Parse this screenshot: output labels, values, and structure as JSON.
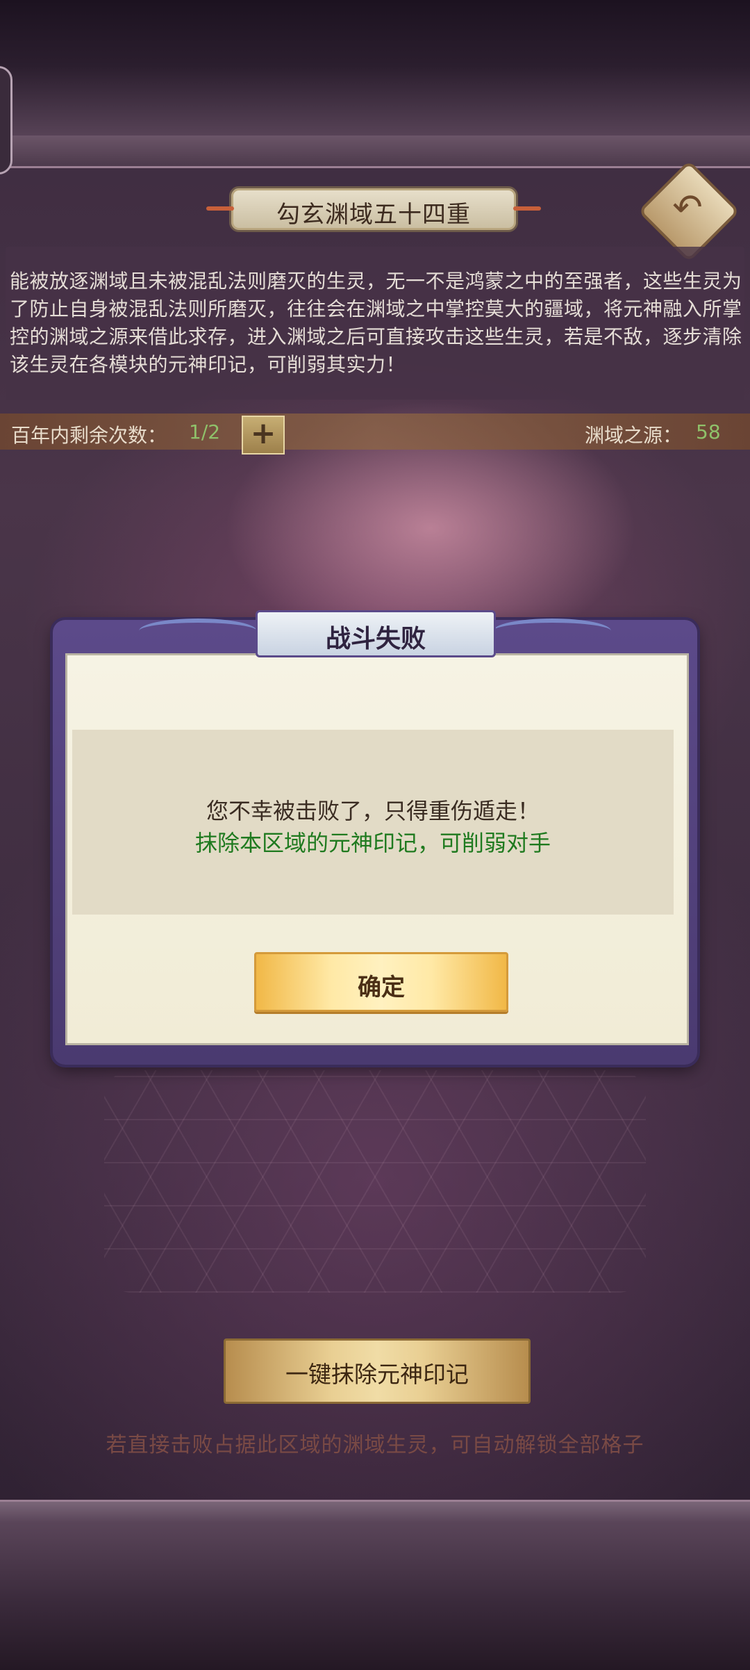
{
  "header": {
    "title": "勾玄渊域五十四重",
    "back_icon": "back-arrow-icon"
  },
  "description": "能被放逐渊域且未被混乱法则磨灭的生灵，无一不是鸿蒙之中的至强者，这些生灵为了防止自身被混乱法则所磨灭，往往会在渊域之中掌控莫大的疆域，将元神融入所掌控的渊域之源来借此求存，进入渊域之后可直接攻击这些生灵，若是不敌，逐步清除该生灵在各模块的元神印记，可削弱其实力！",
  "stats": {
    "remaining_label": "百年内剩余次数：",
    "remaining_value": "1/2",
    "plus_label": "+",
    "source_label": "渊域之源：",
    "source_value": "58"
  },
  "modal": {
    "title": "战斗失败",
    "line1": "您不幸被击败了，只得重伤遁走！",
    "line2": "抹除本区域的元神印记，可削弱对手",
    "confirm_label": "确定"
  },
  "footer": {
    "erase_button": "一键抹除元神印记",
    "hint": "若直接击败占据此区域的渊域生灵，可自动解锁全部格子"
  },
  "colors": {
    "green_text": "#1f7a1f",
    "value_green": "#8fc16a",
    "modal_frame": "#5c4a8a"
  }
}
